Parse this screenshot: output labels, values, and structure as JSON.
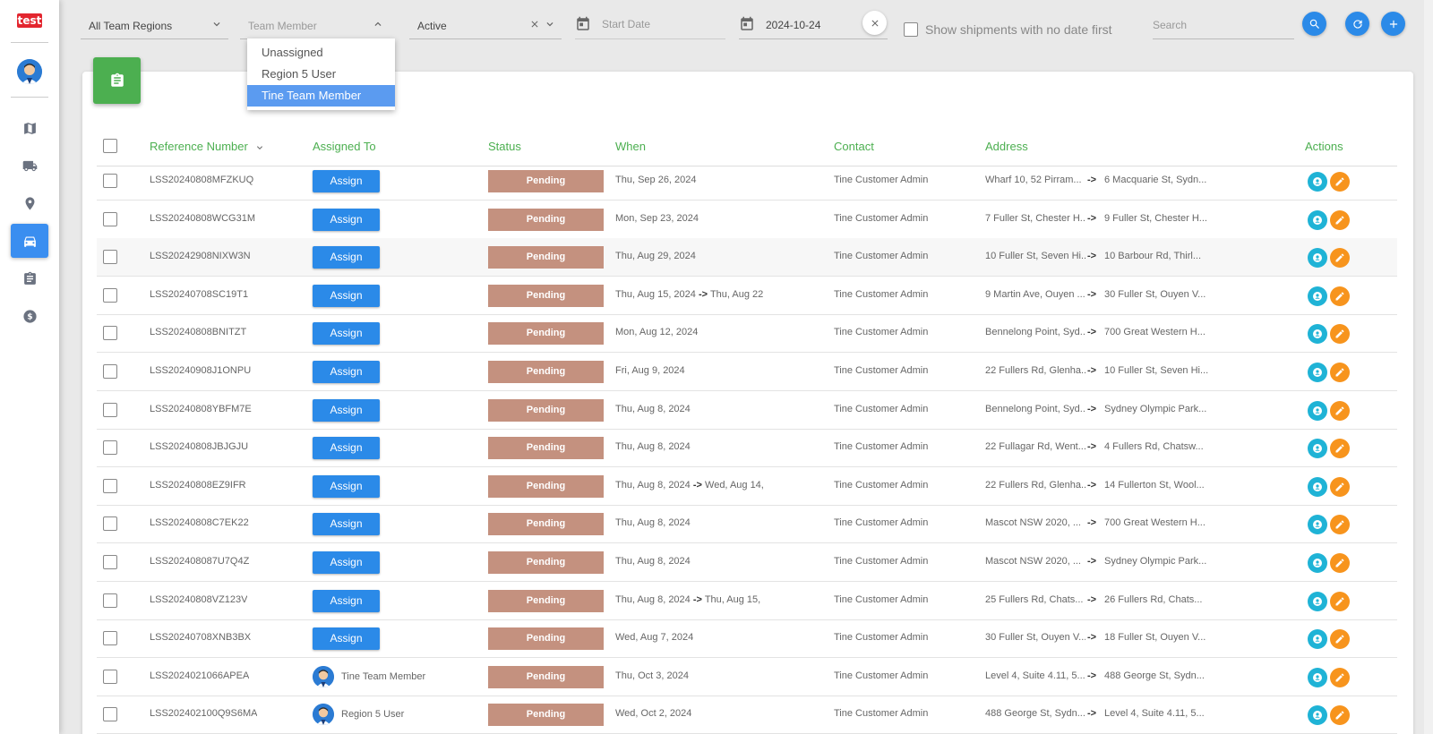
{
  "app": {
    "logo_text": "test"
  },
  "sidebar": {
    "items": [
      {
        "name": "map-icon"
      },
      {
        "name": "truck-icon"
      },
      {
        "name": "location-pin-icon"
      },
      {
        "name": "car-icon",
        "active": true
      },
      {
        "name": "clipboard-icon"
      },
      {
        "name": "dollar-icon"
      }
    ]
  },
  "filters": {
    "region": "All Team Regions",
    "team_member_placeholder": "Team Member",
    "status": "Active",
    "start_date_placeholder": "Start Date",
    "end_date": "2024-10-24",
    "no_date_label": "Show shipments with no date first",
    "search_placeholder": "Search"
  },
  "dropdown": {
    "options": [
      "Unassigned",
      "Region 5 User",
      "Tine Team Member"
    ],
    "selected_index": 2
  },
  "table": {
    "headers": {
      "reference": "Reference Number",
      "assigned": "Assigned To",
      "status": "Status",
      "when": "When",
      "contact": "Contact",
      "address": "Address",
      "actions": "Actions"
    },
    "assign_label": "Assign",
    "arrow": "->",
    "rows": [
      {
        "ref": "LSS20240808MFZKUQ",
        "assigned": "",
        "status": "Pending",
        "when": "Thu, Sep 26, 2024",
        "when_end": "",
        "contact": "Tine Customer Admin",
        "from": "Wharf 10, 52 Pirram...",
        "to": "6 Macquarie St, Sydn..."
      },
      {
        "ref": "LSS20240808WCG31M",
        "assigned": "",
        "status": "Pending",
        "when": "Mon, Sep 23, 2024",
        "when_end": "",
        "contact": "Tine Customer Admin",
        "from": "7 Fuller St, Chester H...",
        "to": "9 Fuller St, Chester H..."
      },
      {
        "ref": "LSS20242908NIXW3N",
        "assigned": "",
        "status": "Pending",
        "when": "Thu, Aug 29, 2024",
        "when_end": "",
        "contact": "Tine Customer Admin",
        "from": "10 Fuller St, Seven Hi...",
        "to": "10 Barbour Rd, Thirl..."
      },
      {
        "ref": "LSS20240708SC19T1",
        "assigned": "",
        "status": "Pending",
        "when": "Thu, Aug 15, 2024",
        "when_end": "Thu, Aug 22",
        "contact": "Tine Customer Admin",
        "from": "9 Martin Ave, Ouyen ...",
        "to": "30 Fuller St, Ouyen V..."
      },
      {
        "ref": "LSS20240808BNITZT",
        "assigned": "",
        "status": "Pending",
        "when": "Mon, Aug 12, 2024",
        "when_end": "",
        "contact": "Tine Customer Admin",
        "from": "Bennelong Point, Syd...",
        "to": "700 Great Western H..."
      },
      {
        "ref": "LSS20240908J1ONPU",
        "assigned": "",
        "status": "Pending",
        "when": "Fri, Aug 9, 2024",
        "when_end": "",
        "contact": "Tine Customer Admin",
        "from": "22 Fullers Rd, Glenha...",
        "to": "10 Fuller St, Seven Hi..."
      },
      {
        "ref": "LSS20240808YBFM7E",
        "assigned": "",
        "status": "Pending",
        "when": "Thu, Aug 8, 2024",
        "when_end": "",
        "contact": "Tine Customer Admin",
        "from": "Bennelong Point, Syd...",
        "to": "Sydney Olympic Park..."
      },
      {
        "ref": "LSS20240808JBJGJU",
        "assigned": "",
        "status": "Pending",
        "when": "Thu, Aug 8, 2024",
        "when_end": "",
        "contact": "Tine Customer Admin",
        "from": "22 Fullagar Rd, Went...",
        "to": "4 Fullers Rd, Chatsw..."
      },
      {
        "ref": "LSS20240808EZ9IFR",
        "assigned": "",
        "status": "Pending",
        "when": "Thu, Aug 8, 2024",
        "when_end": "Wed, Aug 14,",
        "contact": "Tine Customer Admin",
        "from": "22 Fullers Rd, Glenha...",
        "to": "14 Fullerton St, Wool..."
      },
      {
        "ref": "LSS20240808C7EK22",
        "assigned": "",
        "status": "Pending",
        "when": "Thu, Aug 8, 2024",
        "when_end": "",
        "contact": "Tine Customer Admin",
        "from": "Mascot NSW 2020, ...",
        "to": "700 Great Western H..."
      },
      {
        "ref": "LSS202408087U7Q4Z",
        "assigned": "",
        "status": "Pending",
        "when": "Thu, Aug 8, 2024",
        "when_end": "",
        "contact": "Tine Customer Admin",
        "from": "Mascot NSW 2020, ...",
        "to": "Sydney Olympic Park..."
      },
      {
        "ref": "LSS20240808VZ123V",
        "assigned": "",
        "status": "Pending",
        "when": "Thu, Aug 8, 2024",
        "when_end": "Thu, Aug 15,",
        "contact": "Tine Customer Admin",
        "from": "25 Fullers Rd, Chats...",
        "to": "26 Fullers Rd, Chats..."
      },
      {
        "ref": "LSS20240708XNB3BX",
        "assigned": "",
        "status": "Pending",
        "when": "Wed, Aug 7, 2024",
        "when_end": "",
        "contact": "Tine Customer Admin",
        "from": "30 Fuller St, Ouyen V...",
        "to": "18 Fuller St, Ouyen V..."
      },
      {
        "ref": "LSS2024021066APEA",
        "assigned": "Tine Team Member",
        "status": "Pending",
        "when": "Thu, Oct 3, 2024",
        "when_end": "",
        "contact": "Tine Customer Admin",
        "from": "Level 4, Suite 4.11, 5...",
        "to": "488 George St, Sydn..."
      },
      {
        "ref": "LSS202402100Q9S6MA",
        "assigned": "Region 5 User",
        "status": "Pending",
        "when": "Wed, Oct 2, 2024",
        "when_end": "",
        "contact": "Tine Customer Admin",
        "from": "488 George St, Sydn...",
        "to": "Level 4, Suite 4.11, 5..."
      }
    ]
  }
}
